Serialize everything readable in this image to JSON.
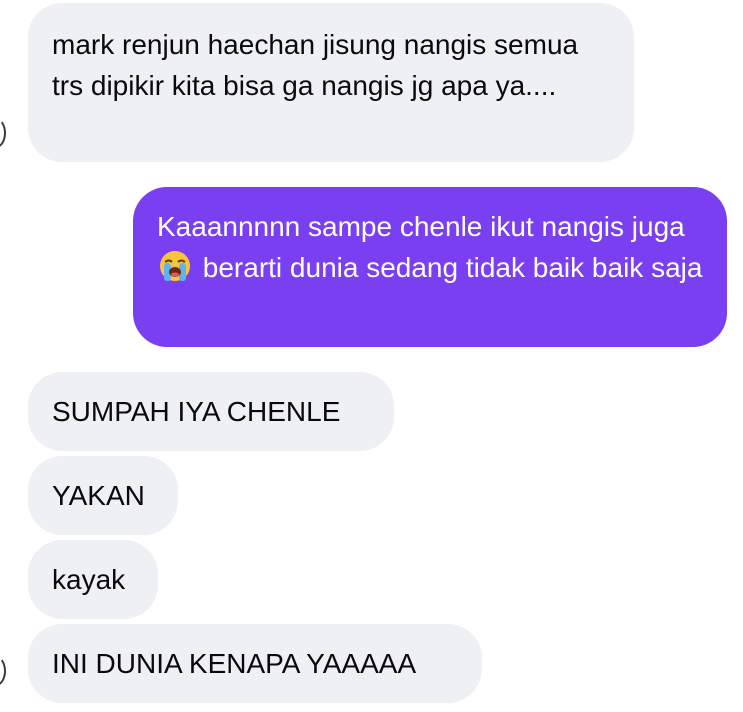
{
  "messages": [
    {
      "side": "incoming",
      "text": "mark renjun haechan jisung nangis semua trs dipikir kita bisa ga nangis jg apa ya...."
    },
    {
      "side": "outgoing",
      "text_before": "Kaaannnnn sampe chenle ikut nangis juga",
      "emoji": "loudly-crying-face-icon",
      "text_after": " berarti dunia sedang tidak baik baik saja"
    },
    {
      "side": "incoming",
      "text": "SUMPAH IYA CHENLE"
    },
    {
      "side": "incoming",
      "text": "YAKAN"
    },
    {
      "side": "incoming",
      "text": "kayak"
    },
    {
      "side": "incoming",
      "text": "INI DUNIA KENAPA YAAAAA"
    }
  ],
  "colors": {
    "incoming_bubble": "#eff0f3",
    "outgoing_bubble": "#7a3ff0",
    "incoming_text": "#0a0a0a",
    "outgoing_text": "#ffffff"
  }
}
